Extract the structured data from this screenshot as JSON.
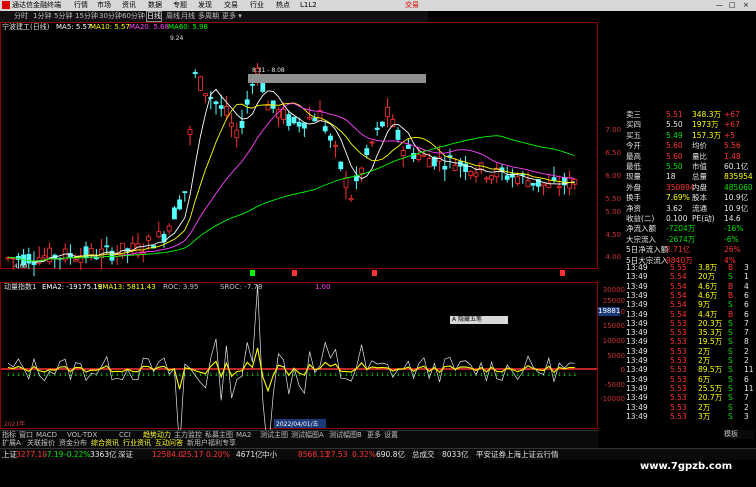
{
  "menu": {
    "app_title": "通达信金融终端",
    "items": [
      "行情",
      "市场",
      "资讯",
      "数据",
      "专题",
      "发现",
      "交易",
      "行业",
      "热点",
      "L1L2"
    ],
    "trade_label": "交易",
    "controls": [
      "—",
      "□",
      "×"
    ]
  },
  "periods": {
    "items": [
      "分时",
      "1分钟",
      "5分钟",
      "15分钟",
      "30分钟",
      "60分钟",
      "日线",
      "周线",
      "月线",
      "多周期",
      "更多 ▾"
    ],
    "active": "日线"
  },
  "stock": {
    "name": "宁波建工(日线)",
    "ma_labels": [
      "MA5: 5.57",
      "MA10: 5.57",
      "MA20: 5.68",
      "MA60: 5.98"
    ],
    "ma_colors": [
      "#ffffff",
      "#ffff00",
      "#ff40ff",
      "#00ff00"
    ],
    "hi_annot": "9.24",
    "range_annot": "8.31 - 8.08",
    "low_annot": "4.69"
  },
  "price_axis": [
    "7.00",
    "6.50",
    "6.00",
    "5.50",
    "5.00",
    "4.50",
    "4.00"
  ],
  "indicator": {
    "name": "动量指数1",
    "labels": [
      {
        "text": "EMA2: -19175.19",
        "color": "#ffffff"
      },
      {
        "text": "EMA13: 5811.43",
        "color": "#ffff00"
      },
      {
        "text": "ROC: 3.95",
        "color": "#c0c0c0"
      },
      {
        "text": "SROC: -7.78",
        "color": "#c0c0c0"
      },
      {
        "text": "1.00",
        "color": "#ff40ff"
      }
    ],
    "axis": [
      "30000",
      "25000",
      "20000",
      "15000",
      "10000",
      "5000",
      "0",
      "-5000",
      "-10000"
    ],
    "cur_value": "19881",
    "button": "A 隐藏五笔"
  },
  "time_axis": {
    "left": "2021年",
    "mid": "2022/04/01/五"
  },
  "quote": {
    "rows": [
      {
        "label": "卖三",
        "v1": "5.51",
        "v2": "348.3万",
        "v3": "+67",
        "c1": "red",
        "c2": "yellow",
        "c3": "red"
      },
      {
        "label": "买四",
        "v1": "5.50",
        "v2": "1973万",
        "v3": "+67",
        "c1": "white",
        "c2": "yellow",
        "c3": "red"
      },
      {
        "label": "买五",
        "v1": "5.49",
        "v2": "157.3万",
        "v3": "+5",
        "c1": "green",
        "c2": "yellow",
        "c3": "red"
      },
      {
        "label": "今开",
        "v1": "5.60",
        "v2": "均价",
        "v3": "5.56",
        "c1": "red",
        "c2": "white",
        "c3": "red"
      },
      {
        "label": "最高",
        "v1": "5.60",
        "v2": "量比",
        "v3": "1.48",
        "c1": "red",
        "c2": "white",
        "c3": "red"
      },
      {
        "label": "最低",
        "v1": "5.50",
        "v2": "市值",
        "v3": "60.1亿",
        "c1": "green",
        "c2": "white",
        "c3": "white"
      },
      {
        "label": "现量",
        "v1": "18",
        "v2": "总量",
        "v3": "835954",
        "c1": "white",
        "c2": "white",
        "c3": "yellow"
      },
      {
        "label": "外盘",
        "v1": "350894",
        "v2": "内盘",
        "v3": "485060",
        "c1": "red",
        "c2": "white",
        "c3": "green"
      },
      {
        "label": "换手",
        "v1": "7.69%",
        "v2": "股本",
        "v3": "10.9亿",
        "c1": "yellow",
        "c2": "white",
        "c3": "white"
      },
      {
        "label": "净资",
        "v1": "3.62",
        "v2": "流通",
        "v3": "10.9亿",
        "c1": "white",
        "c2": "white",
        "c3": "white"
      },
      {
        "label": "收益(二)",
        "v1": "0.100",
        "v2": "PE(动)",
        "v3": "14.6",
        "c1": "white",
        "c2": "white",
        "c3": "white"
      },
      {
        "label": "净流入额",
        "v1": "-7204万",
        "v2": "",
        "v3": "-16%",
        "c1": "green",
        "c2": "",
        "c3": "green"
      },
      {
        "label": "大宗流入",
        "v1": "-2674万",
        "v2": "",
        "v3": "-6%",
        "c1": "green",
        "c2": "",
        "c3": "green"
      },
      {
        "label": "5日净流入额",
        "v1": "2.71亿",
        "v2": "",
        "v3": "26%",
        "c1": "red",
        "c2": "",
        "c3": "red"
      },
      {
        "label": "5日大宗流入",
        "v1": "9840万",
        "v2": "",
        "v3": "4%",
        "c1": "red",
        "c2": "",
        "c3": "red"
      }
    ]
  },
  "ticks": [
    {
      "t": "13:49",
      "p": "5.55",
      "v": "3.8万",
      "s": "B",
      "n": "3"
    },
    {
      "t": "13:49",
      "p": "5.54",
      "v": "20万",
      "s": "S",
      "n": "1"
    },
    {
      "t": "13:49",
      "p": "5.54",
      "v": "4.6万",
      "s": "B",
      "n": "4"
    },
    {
      "t": "13:49",
      "p": "5.54",
      "v": "4.6万",
      "s": "B",
      "n": "6"
    },
    {
      "t": "13:49",
      "p": "5.54",
      "v": "9万",
      "s": "S",
      "n": "6"
    },
    {
      "t": "13:49",
      "p": "5.54",
      "v": "4.4万",
      "s": "B",
      "n": "6"
    },
    {
      "t": "13:49",
      "p": "5.53",
      "v": "20.3万",
      "s": "S",
      "n": "7"
    },
    {
      "t": "13:49",
      "p": "5.53",
      "v": "35.3万",
      "s": "S",
      "n": "7"
    },
    {
      "t": "13:49",
      "p": "5.53",
      "v": "19.5万",
      "s": "S",
      "n": "8"
    },
    {
      "t": "13:49",
      "p": "5.53",
      "v": "2万",
      "s": "S",
      "n": "2"
    },
    {
      "t": "13:49",
      "p": "5.53",
      "v": "2万",
      "s": "S",
      "n": "2"
    },
    {
      "t": "13:49",
      "p": "5.53",
      "v": "89.5万",
      "s": "S",
      "n": "11"
    },
    {
      "t": "13:49",
      "p": "5.53",
      "v": "6万",
      "s": "S",
      "n": "6"
    },
    {
      "t": "13:49",
      "p": "5.53",
      "v": "25.5万",
      "s": "S",
      "n": "11"
    },
    {
      "t": "13:49",
      "p": "5.53",
      "v": "20.7万",
      "s": "S",
      "n": "7"
    },
    {
      "t": "13:49",
      "p": "5.53",
      "v": "2万",
      "s": "S",
      "n": "2"
    },
    {
      "t": "13:49",
      "p": "5.53",
      "v": "3万",
      "s": "S",
      "n": "3"
    }
  ],
  "tabs": [
    "指标",
    "窗口",
    "MACD",
    "VOL-TDX",
    "CCI",
    "趋势动力",
    "主力监控",
    "私募主图",
    "MA2",
    "测试主图",
    "测试幅图A",
    "测试幅图B",
    "更多",
    "设置"
  ],
  "tabs_active": "趋势动力",
  "tabs2": [
    "扩展A",
    "关联报价",
    "资金分布",
    "综合资讯",
    "行业资讯",
    "互动问答",
    "新用户福利专享"
  ],
  "status": {
    "items": [
      {
        "label": "上证",
        "c": "white"
      },
      {
        "label": "3277.10",
        "c": "red"
      },
      {
        "label": "-7.19",
        "c": "green"
      },
      {
        "label": "-0.22%",
        "c": "green"
      },
      {
        "label": "3363亿",
        "c": "white"
      },
      {
        "label": "深证",
        "c": "white"
      },
      {
        "label": "12584.0",
        "c": "red"
      },
      {
        "label": "25.17",
        "c": "red"
      },
      {
        "label": "0.20%",
        "c": "red"
      },
      {
        "label": "4671亿",
        "c": "white"
      },
      {
        "label": "中小",
        "c": "white"
      },
      {
        "label": "8568.13",
        "c": "red"
      },
      {
        "label": "27.53",
        "c": "red"
      },
      {
        "label": "0.32%",
        "c": "red"
      },
      {
        "label": "690.8亿",
        "c": "white"
      },
      {
        "label": "总成交",
        "c": "white"
      },
      {
        "label": "8033亿",
        "c": "white"
      },
      {
        "label": "平安证券上海上证云行情",
        "c": "white"
      }
    ],
    "right_tag": "模板",
    "watermark": "www.7gpzb.com"
  }
}
